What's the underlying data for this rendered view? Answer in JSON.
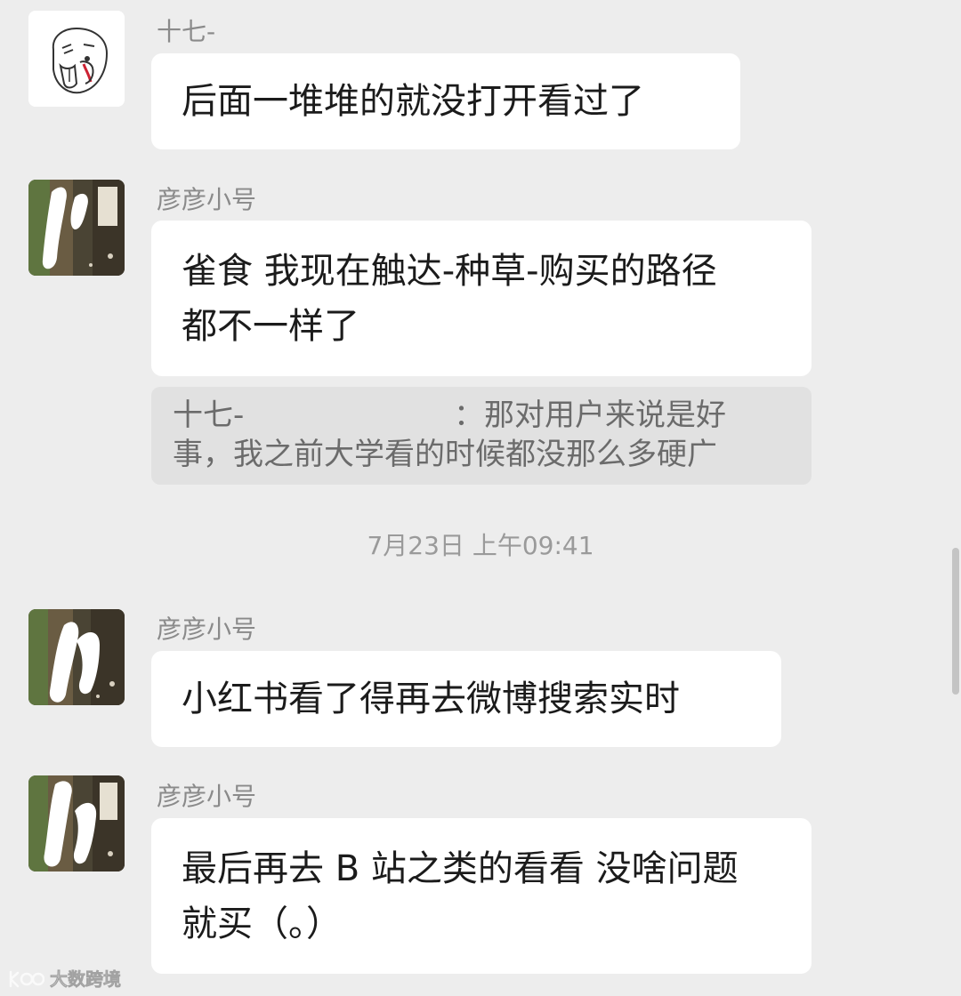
{
  "messages": [
    {
      "sender": "十七-",
      "lines": [
        "后面一堆堆的就没打开看过了"
      ]
    },
    {
      "sender": "彦彦小号",
      "lines": [
        "雀食 我现在触达-种草-购买的路径",
        "都不一样了"
      ],
      "quote": {
        "sender": "十七-",
        "text_line1": "：那对用户来说是好",
        "text_line2": "事，我之前大学看的时候都没那么多硬广"
      }
    },
    {
      "sender": "彦彦小号",
      "lines": [
        "小红书看了得再去微博搜索实时"
      ]
    },
    {
      "sender": "彦彦小号",
      "lines": [
        "最后再去 B 站之类的看看 没啥问题",
        "就买（。）"
      ]
    }
  ],
  "timestamp": "7月23日 上午09:41",
  "watermark": {
    "text": "大数跨境"
  },
  "colors": {
    "background": "#ededed",
    "bubble": "#ffffff",
    "quote_bg": "#e1e1e1",
    "sender_text": "#8a8a8a",
    "message_text": "#1b1b1b"
  },
  "icons": {
    "avatar_1": "funny-face-sketch-avatar-icon",
    "avatar_2": "photo-avatar-icon",
    "watermark_logo": "brand-logo-icon"
  }
}
